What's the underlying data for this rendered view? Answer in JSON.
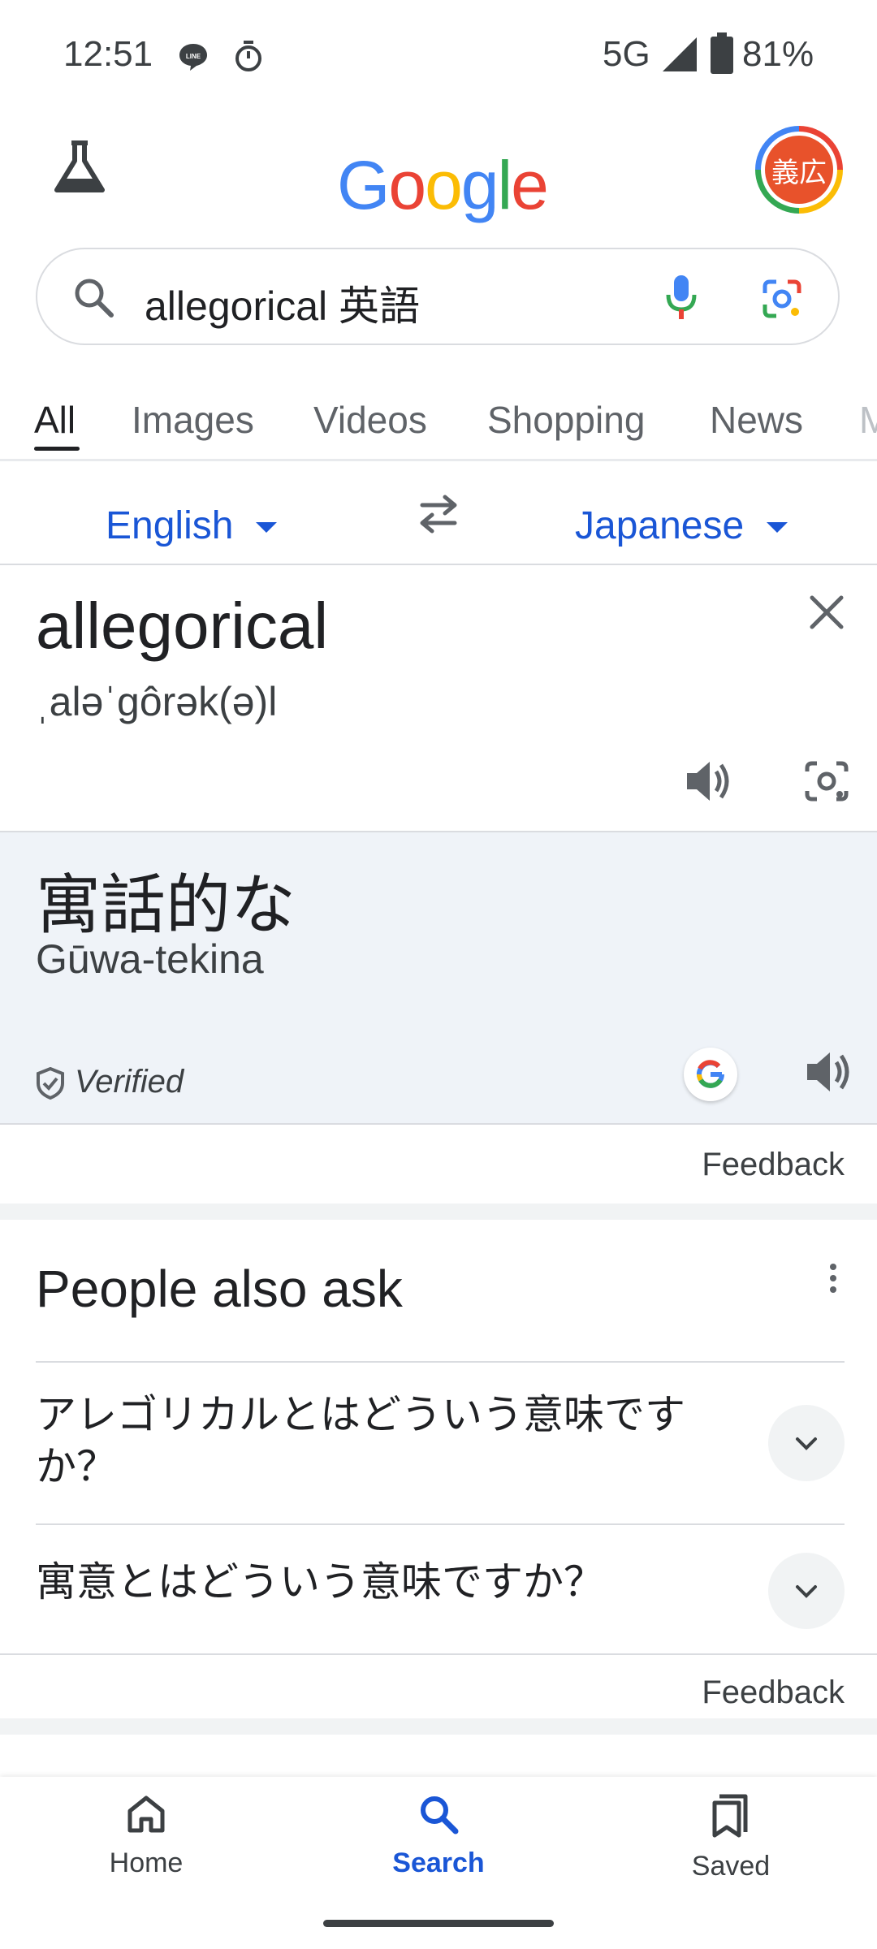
{
  "status_bar": {
    "time": "12:51",
    "network": "5G",
    "battery": "81%"
  },
  "header": {
    "logo": "Google",
    "avatar_text": "義広"
  },
  "search": {
    "query": "allegorical 英語"
  },
  "tabs": [
    "All",
    "Images",
    "Videos",
    "Shopping",
    "News",
    "M"
  ],
  "translate": {
    "source_lang": "English",
    "target_lang": "Japanese",
    "source_text": "allegorical",
    "phonetic": "ˌaləˈgôrək(ə)l",
    "result_text": "寓話的な",
    "romanization": "Gūwa-tekina",
    "verified_label": "Verified",
    "feedback": "Feedback"
  },
  "people_also_ask": {
    "title": "People also ask",
    "questions": [
      "アレゴリカルとはどういう意味ですか？",
      "寓意とはどういう意味ですか？"
    ],
    "feedback": "Feedback"
  },
  "bottom_nav": {
    "home": "Home",
    "search": "Search",
    "saved": "Saved"
  },
  "colors": {
    "accent": "#1a56d6",
    "result_bg": "#eff3f8"
  }
}
